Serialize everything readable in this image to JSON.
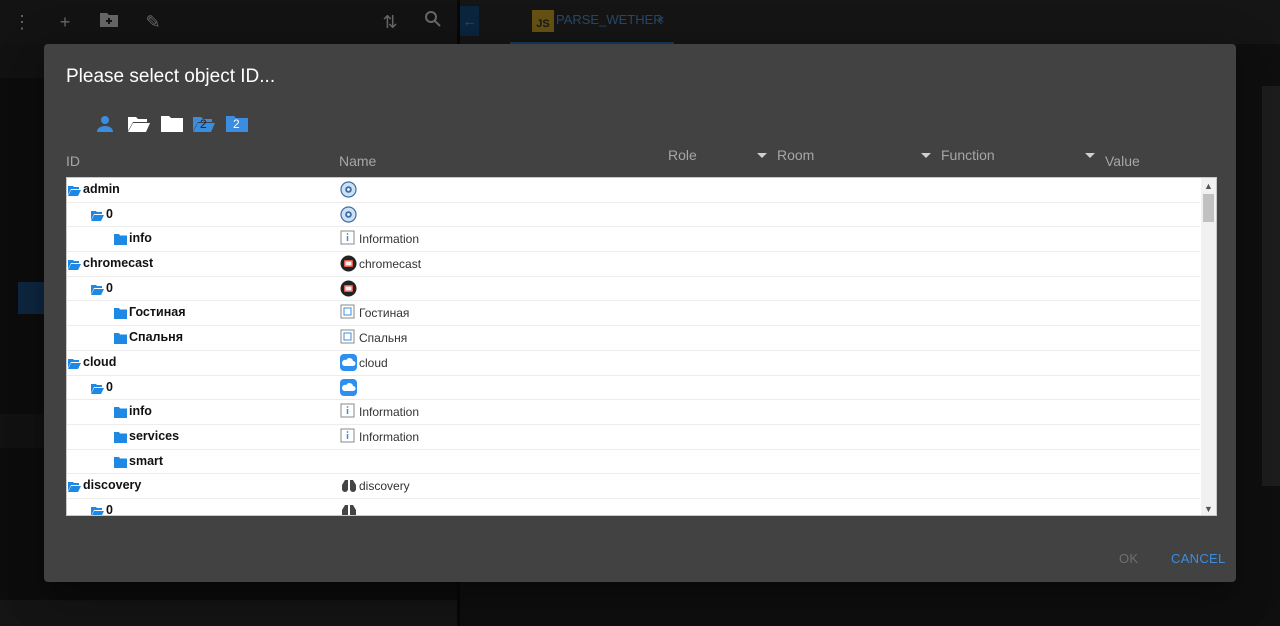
{
  "app": {
    "tab_title": "PARSE_WETHER",
    "tab_close": "×",
    "tab_badge": "JS"
  },
  "dialog": {
    "title": "Please select object ID...",
    "ok_label": "OK",
    "cancel_label": "CANCEL",
    "filter_badge_1": "2",
    "filter_badge_2": "2",
    "columns": {
      "id": "ID",
      "name": "Name",
      "role": "Role",
      "room": "Room",
      "function": "Function",
      "value": "Value"
    }
  },
  "tree_rows": [
    {
      "id": "admin",
      "name": "",
      "level": 0,
      "open": true,
      "icon": "gear-icon"
    },
    {
      "id": "0",
      "name": "",
      "level": 1,
      "open": true,
      "icon": "gear-icon"
    },
    {
      "id": "info",
      "name": "Information",
      "level": 2,
      "open": false,
      "icon": "info-icon"
    },
    {
      "id": "chromecast",
      "name": "chromecast",
      "level": 0,
      "open": true,
      "icon": "chromecast-icon"
    },
    {
      "id": "0",
      "name": "",
      "level": 1,
      "open": true,
      "icon": "chromecast-icon"
    },
    {
      "id": "Гостиная",
      "name": "Гостиная",
      "level": 2,
      "open": false,
      "icon": "device-icon"
    },
    {
      "id": "Спальня",
      "name": "Спальня",
      "level": 2,
      "open": false,
      "icon": "device-icon"
    },
    {
      "id": "cloud",
      "name": "cloud",
      "level": 0,
      "open": true,
      "icon": "cloud-icon"
    },
    {
      "id": "0",
      "name": "",
      "level": 1,
      "open": true,
      "icon": "cloud-icon"
    },
    {
      "id": "info",
      "name": "Information",
      "level": 2,
      "open": false,
      "icon": "info-icon"
    },
    {
      "id": "services",
      "name": "Information",
      "level": 2,
      "open": false,
      "icon": "info-icon"
    },
    {
      "id": "smart",
      "name": "",
      "level": 2,
      "open": false,
      "icon": ""
    },
    {
      "id": "discovery",
      "name": "discovery",
      "level": 0,
      "open": true,
      "icon": "binoculars-icon"
    },
    {
      "id": "0",
      "name": "",
      "level": 1,
      "open": true,
      "icon": "binoculars-icon"
    }
  ]
}
